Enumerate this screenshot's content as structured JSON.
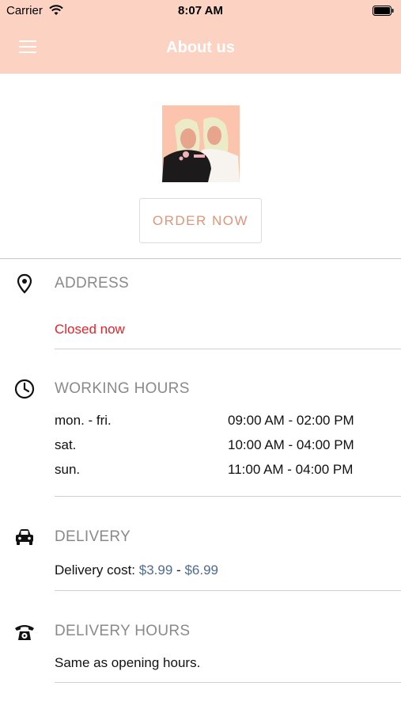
{
  "status_bar": {
    "carrier": "Carrier",
    "time": "8:07 AM"
  },
  "nav": {
    "title": "About us"
  },
  "order_button": {
    "label": "ORDER NOW"
  },
  "address": {
    "title": "ADDRESS",
    "status": "Closed now"
  },
  "working_hours": {
    "title": "WORKING HOURS",
    "rows": [
      {
        "days": "mon. - fri.",
        "hours": "09:00 AM - 02:00 PM"
      },
      {
        "days": "sat.",
        "hours": "10:00 AM - 04:00 PM"
      },
      {
        "days": "sun.",
        "hours": "11:00 AM - 04:00 PM"
      }
    ]
  },
  "delivery": {
    "title": "DELIVERY",
    "cost_label": "Delivery cost:",
    "min_price": "$3.99",
    "separator": "-",
    "max_price": "$6.99"
  },
  "delivery_hours": {
    "title": "DELIVERY HOURS",
    "text": "Same as opening hours."
  },
  "colors": {
    "header": "#fcd3c2",
    "accent": "#e0957a",
    "closed": "#e3242b",
    "price": "#4f6b8c"
  },
  "icons": [
    "menu-icon",
    "wifi-icon",
    "battery-icon",
    "map-pin-icon",
    "clock-icon",
    "car-icon",
    "phone-icon"
  ]
}
